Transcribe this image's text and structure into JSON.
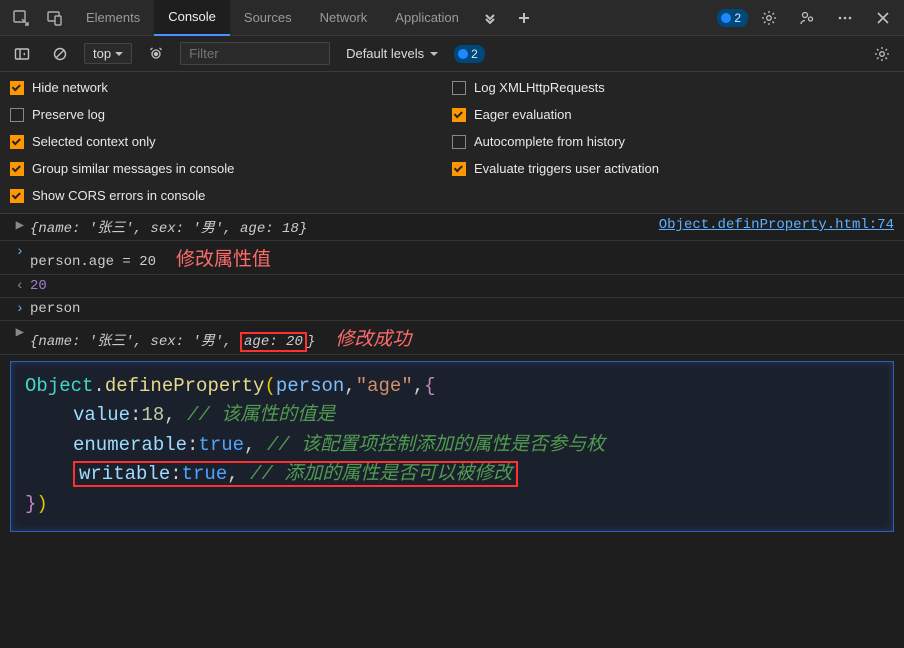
{
  "tabs": {
    "items": [
      "Elements",
      "Console",
      "Sources",
      "Network",
      "Application"
    ],
    "active_index": 1,
    "badge_count": "2"
  },
  "toolbar": {
    "context": "top",
    "filter_placeholder": "Filter",
    "levels_label": "Default levels",
    "inner_badge": "2"
  },
  "settings": {
    "left": [
      {
        "label": "Hide network",
        "checked": true
      },
      {
        "label": "Preserve log",
        "checked": false
      },
      {
        "label": "Selected context only",
        "checked": true
      },
      {
        "label": "Group similar messages in console",
        "checked": true
      },
      {
        "label": "Show CORS errors in console",
        "checked": true
      }
    ],
    "right": [
      {
        "label": "Log XMLHttpRequests",
        "checked": false
      },
      {
        "label": "Eager evaluation",
        "checked": true
      },
      {
        "label": "Autocomplete from history",
        "checked": false
      },
      {
        "label": "Evaluate triggers user activation",
        "checked": true
      }
    ]
  },
  "console_rows": {
    "r0_obj": "{name: '张三', sex: '男', age: 18}",
    "r0_link": "Object.definProperty.html:74",
    "r1_input": "person.age = 20",
    "r1_note": "修改属性值",
    "r2_out": "20",
    "r3_input": "person",
    "r4_prefix": "{name: '张三', sex: '男', ",
    "r4_age": "age: 20",
    "r4_suffix": "}",
    "r4_note": "修改成功"
  },
  "code": {
    "line1": {
      "obj": "Object",
      "dot": ".",
      "fn": "defineProperty",
      "open": "(",
      "var": "person",
      "c1": ",",
      "q1": "\"",
      "key": "age",
      "q2": "\"",
      "c2": ",",
      "brace": "{"
    },
    "line2": {
      "prop": "value",
      "colon": ":",
      "val": "18",
      "comma": ", ",
      "comment": "// 该属性的值是"
    },
    "line3": {
      "prop": "enumerable",
      "colon": ":",
      "val": "true",
      "comma": ", ",
      "comment": "// 该配置项控制添加的属性是否参与枚"
    },
    "line4": {
      "prop": "writable",
      "colon": ":",
      "val": "true",
      "comma": ", ",
      "comment": "// 添加的属性是否可以被修改"
    },
    "line5": {
      "brace": "}",
      "paren": ")"
    }
  }
}
